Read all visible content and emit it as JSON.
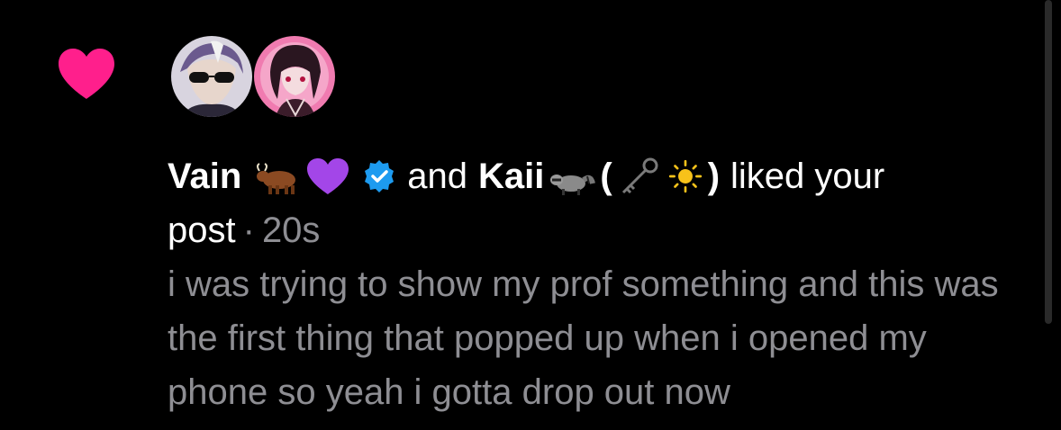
{
  "notification": {
    "user1_name": "Vain",
    "conj": "and",
    "user2_name": "Kaii",
    "paren_open": "(",
    "paren_close": ")",
    "action": "liked your",
    "action2": "post",
    "separator": "·",
    "time": "20s",
    "post_preview": "i was trying to show my prof something and this was the first thing that popped up when i opened my phone so yeah i gotta drop out now"
  },
  "icons": {
    "like": "heart-icon",
    "verified": "verified-badge-icon",
    "user1_emojis": [
      "ox-emoji-icon",
      "purple-heart-emoji-icon"
    ],
    "user2_emojis": [
      "raccoon-emoji-icon",
      "old-key-emoji-icon",
      "sun-emoji-icon"
    ]
  },
  "colors": {
    "background": "#000000",
    "like_heart": "#ff1f8c",
    "verified": "#1d9bf0",
    "primary_text": "#ffffff",
    "secondary_text": "#8e8e93"
  }
}
